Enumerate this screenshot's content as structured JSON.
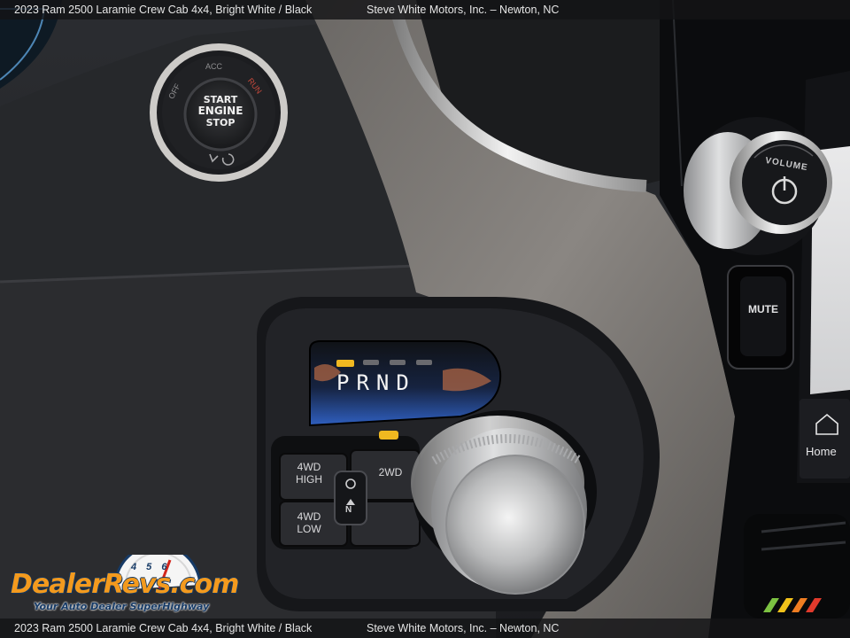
{
  "caption": {
    "top_vehicle": "2023 Ram 2500 Laramie Crew Cab 4x4,   Bright White / Black",
    "top_dealer": "Steve White Motors, Inc.  –  Newton, NC",
    "bottom_vehicle": "2023 Ram 2500 Laramie Crew Cab 4x4,   Bright White / Black",
    "bottom_dealer": "Steve White Motors, Inc.  –  Newton, NC"
  },
  "ignition": {
    "line1": "START",
    "line2": "ENGINE",
    "line3": "STOP",
    "mode_off": "OFF",
    "mode_acc": "ACC",
    "mode_run": "RUN"
  },
  "gear_display": {
    "gears": "PRND"
  },
  "transfer_case": {
    "btn_4wd_high_l1": "4WD",
    "btn_4wd_high_l2": "HIGH",
    "btn_2wd": "2WD",
    "btn_4wd_low_l1": "4WD",
    "btn_4wd_low_l2": "LOW",
    "neutral_label": "N"
  },
  "audio": {
    "volume_label": "VOLUME",
    "mute_label": "MUTE"
  },
  "screen": {
    "home_label": "Home"
  },
  "watermark": {
    "brand": "DealerRevs.com",
    "tagline": "Your Auto Dealer SuperHighway",
    "gauge_digits": "4 5 6"
  },
  "colors": {
    "indicator_amber": "#f0b820",
    "gear_glow": "#2f5fc0",
    "brand_orange": "#f39a1e",
    "brand_navy": "#13365f"
  }
}
